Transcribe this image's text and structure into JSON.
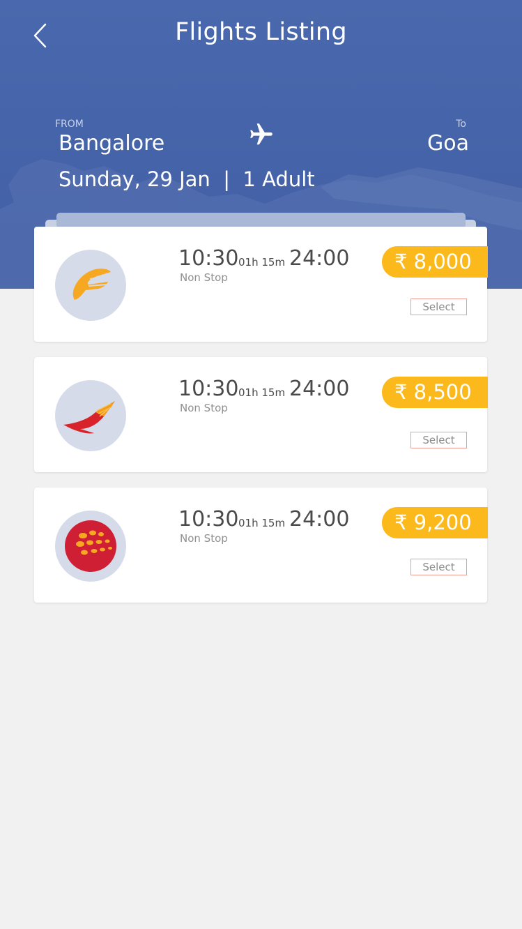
{
  "header": {
    "title": "Flights Listing",
    "from_label": "FROM",
    "from_city": "Bangalore",
    "to_label": "To",
    "to_city": "Goa",
    "trip_info": "Sunday, 29 Jan  |  1 Adult",
    "back_icon": "chevron-left-icon",
    "plane_icon": "airplane-icon"
  },
  "colors": {
    "header_bg": "#4563a8",
    "price_badge": "#fbb91c",
    "select_border": "#f09a93",
    "page_bg": "#f1f1f1"
  },
  "flights": [
    {
      "airline_logo": "jet-airways-logo",
      "departure": "10:30",
      "duration": "01h 15m",
      "arrival": "24:00",
      "stops": "Non Stop",
      "price": "₹ 8,000",
      "select_label": "Select"
    },
    {
      "airline_logo": "air-india-logo",
      "departure": "10:30",
      "duration": "01h 15m",
      "arrival": "24:00",
      "stops": "Non Stop",
      "price": "₹ 8,500",
      "select_label": "Select"
    },
    {
      "airline_logo": "spicejet-logo",
      "departure": "10:30",
      "duration": "01h 15m",
      "arrival": "24:00",
      "stops": "Non Stop",
      "price": "₹ 9,200",
      "select_label": "Select"
    }
  ]
}
